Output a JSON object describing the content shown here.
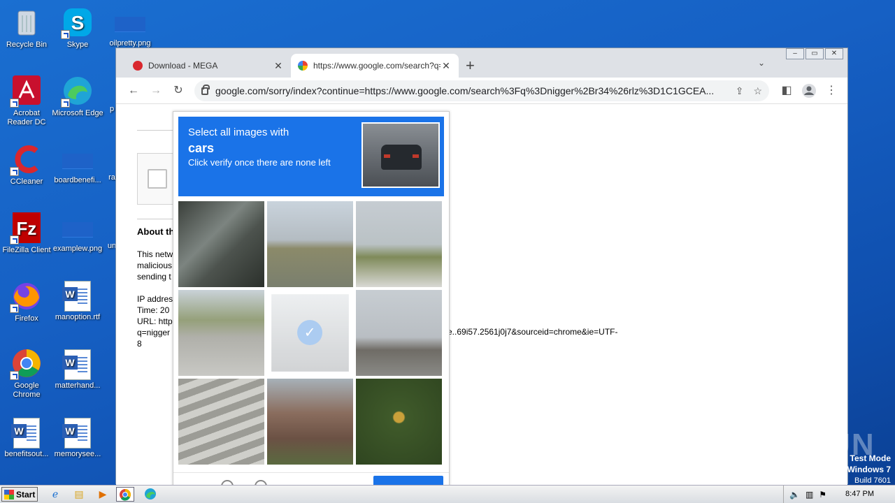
{
  "desktop": {
    "icons": [
      {
        "label": "Recycle Bin"
      },
      {
        "label": "Skype"
      },
      {
        "label": "oilpretty.png"
      },
      {
        "label": "Acrobat Reader DC"
      },
      {
        "label": "Microsoft Edge"
      },
      {
        "label": "p"
      },
      {
        "label": "CCleaner"
      },
      {
        "label": "boardbenefi..."
      },
      {
        "label": "ra"
      },
      {
        "label": "FileZilla Client"
      },
      {
        "label": "examplew.png"
      },
      {
        "label": "un"
      },
      {
        "label": "Firefox"
      },
      {
        "label": "manoption.rtf"
      },
      {
        "label": "Google Chrome"
      },
      {
        "label": "matterhand..."
      },
      {
        "label": "benefitsout..."
      },
      {
        "label": "memorysee..."
      }
    ]
  },
  "browser": {
    "tabs": [
      {
        "title": "Download - MEGA",
        "favicon_color": "#d9272e"
      },
      {
        "title": "https://www.google.com/search?q=",
        "favicon_color": "#4285f4"
      }
    ],
    "url": "google.com/sorry/index?continue=https://www.google.com/search%3Fq%3Dnigger%2Br34%26rlz%3D1C1GCEA..."
  },
  "page": {
    "about_heading": "About th",
    "para1": [
      "This netw",
      "malicious",
      "sending t"
    ],
    "para2": [
      "IP addres",
      "Time: 20",
      "URL: http",
      "q=nigger",
      "8"
    ],
    "url_tail": "e..69i57.2561j0j7&sourceid=chrome&ie=UTF-"
  },
  "captcha": {
    "line1": "Select all images with",
    "target": "cars",
    "line3": "Click verify once there are none left",
    "selected_tile": 4
  },
  "watermark": "ANY RUN",
  "testmode": {
    "line1": "Test Mode",
    "line2": "Windows 7",
    "line3": "Build 7601"
  },
  "taskbar": {
    "start_label": "Start",
    "clock": "8:47 PM"
  }
}
